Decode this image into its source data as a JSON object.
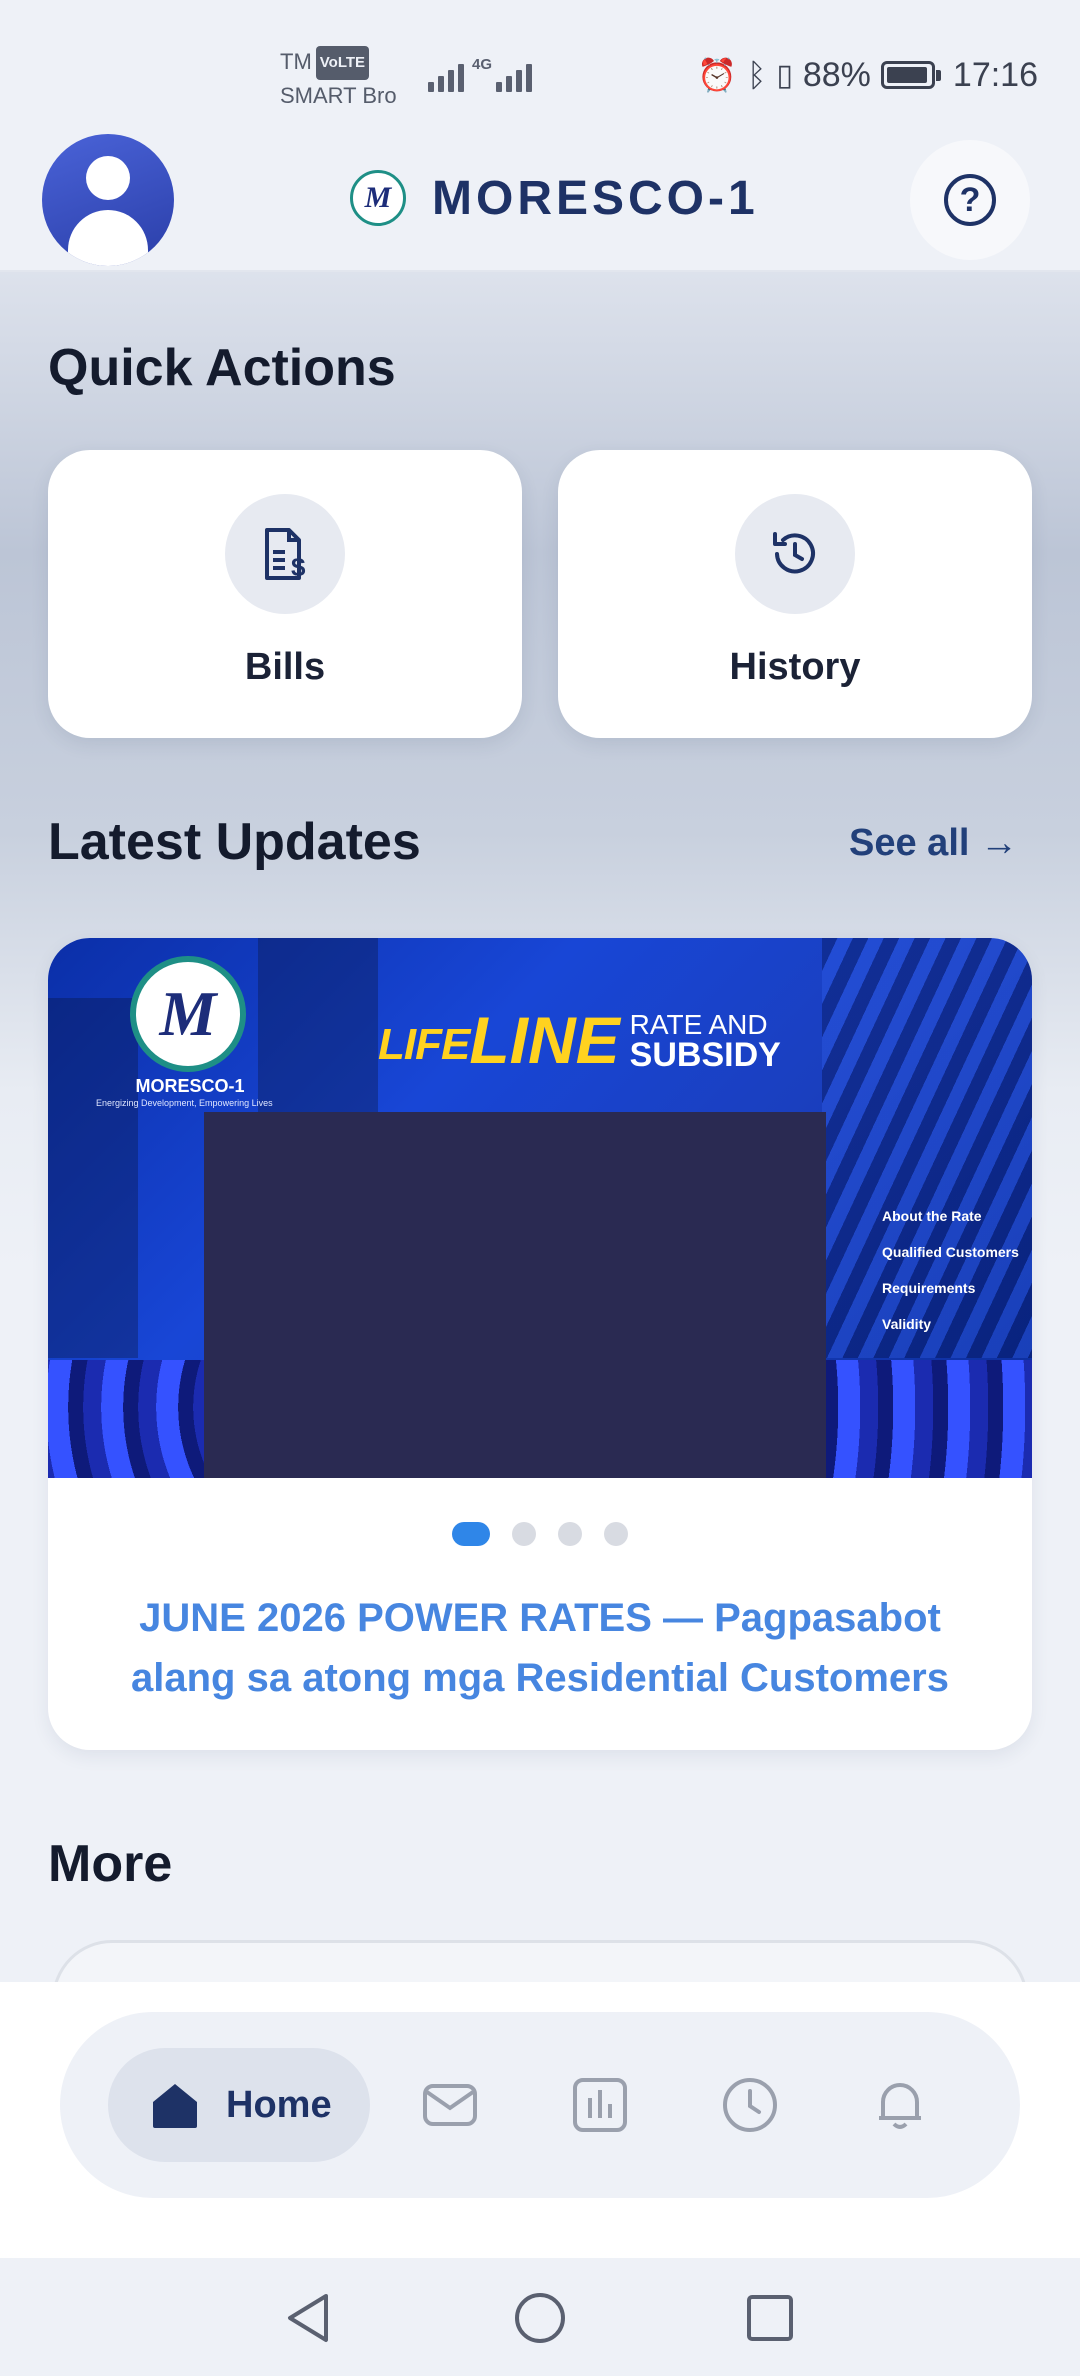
{
  "status_bar": {
    "carrier_line1": "TM",
    "volte": "VoLTE",
    "carrier_line2": "SMART Bro",
    "network": "4G",
    "battery": "88%",
    "time": "17:16"
  },
  "header": {
    "brand_name": "MORESCO-1",
    "logo_mark": "M"
  },
  "quick_actions": {
    "title": "Quick Actions",
    "items": [
      {
        "label": "Bills",
        "icon": "bill-dollar-icon"
      },
      {
        "label": "History",
        "icon": "history-icon"
      }
    ]
  },
  "latest_updates": {
    "title": "Latest Updates",
    "see_all": "See all →",
    "banner": {
      "logo_mark": "M",
      "org": "MORESCO-1",
      "tagline": "Energizing Development, Empowering Lives",
      "title_life": "LIFE",
      "title_line": "LINE",
      "title_rate": "RATE AND",
      "title_subsidy": "SUBSIDY",
      "list": [
        "About the Rate",
        "Qualified Customers",
        "Requirements",
        "Validity"
      ]
    },
    "carousel_count": 4,
    "active_index": 0,
    "headline": "JUNE 2026 POWER RATES — Pagpasabot alang sa atong mga Residential Customers"
  },
  "more": {
    "title": "More"
  },
  "bottom_nav": {
    "items": [
      {
        "label": "Home",
        "icon": "home-icon",
        "active": true
      },
      {
        "label": "",
        "icon": "mail-icon"
      },
      {
        "label": "",
        "icon": "chart-icon"
      },
      {
        "label": "",
        "icon": "clock-icon"
      },
      {
        "label": "",
        "icon": "bell-icon"
      }
    ]
  },
  "colors": {
    "accent": "#2f86e8",
    "brand_navy": "#1e3266",
    "headline": "#4786e0",
    "lifeline_yellow": "#ffd21f"
  }
}
